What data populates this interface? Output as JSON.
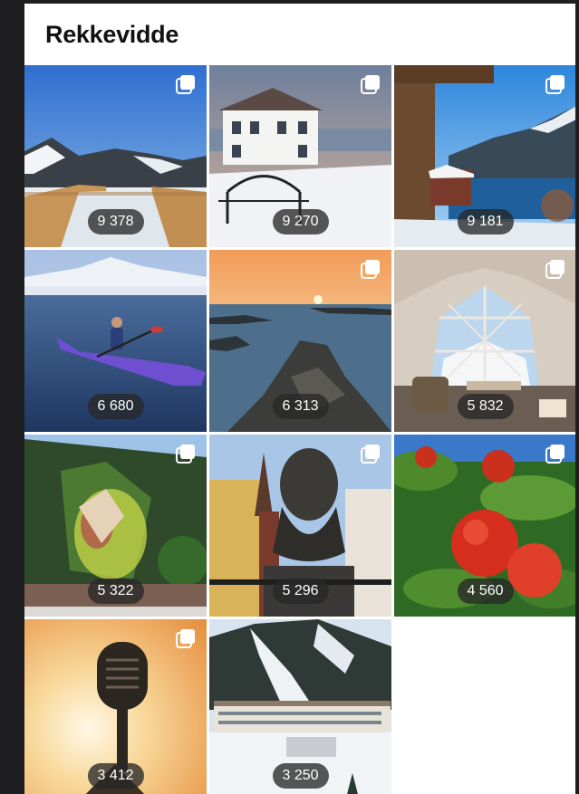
{
  "header": {
    "title": "Rekkevidde"
  },
  "tiles": [
    {
      "count": "9 378",
      "icon": "multi-image-icon",
      "scene": "mountain-boardwalk"
    },
    {
      "count": "9 270",
      "icon": "multi-image-icon",
      "scene": "white-house-snow"
    },
    {
      "count": "9 181",
      "icon": "multi-image-icon",
      "scene": "cabin-fjord"
    },
    {
      "count": "6 680",
      "icon": "",
      "scene": "kayak-lake"
    },
    {
      "count": "6 313",
      "icon": "multi-image-icon",
      "scene": "sunset-islands"
    },
    {
      "count": "5 832",
      "icon": "multi-image-icon",
      "scene": "glamping-dome"
    },
    {
      "count": "5 322",
      "icon": "multi-image-icon",
      "scene": "mural-wall"
    },
    {
      "count": "5 296",
      "icon": "multi-image-icon",
      "scene": "bust-statue"
    },
    {
      "count": "4 560",
      "icon": "multi-image-icon",
      "scene": "apples"
    },
    {
      "count": "3 412",
      "icon": "multi-image-icon",
      "scene": "microphone-sunset"
    },
    {
      "count": "3 250",
      "icon": "",
      "scene": "ski-resort"
    }
  ]
}
